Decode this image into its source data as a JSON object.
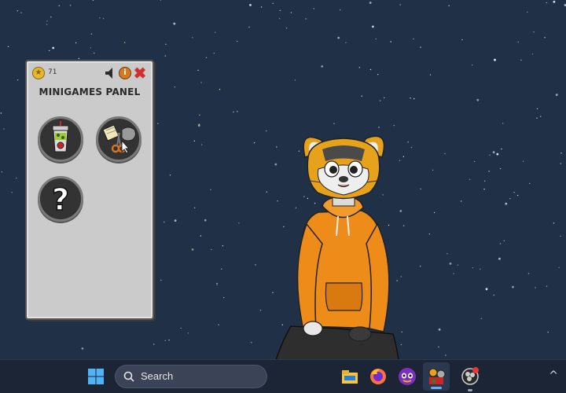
{
  "panel": {
    "title": "MINIGAMES PANEL",
    "coin_count": "71",
    "coin_symbol": "★",
    "info_symbol": "i",
    "close_symbol": "✖",
    "games": [
      {
        "name": "cauldron-game",
        "icon": "potion-bucket-icon"
      },
      {
        "name": "rock-paper-scissors-game",
        "icon": "rock-paper-scissors-icon"
      },
      {
        "name": "mystery-game",
        "icon": "question-mark-icon",
        "symbol": "?"
      }
    ]
  },
  "taskbar": {
    "search_placeholder": "Search",
    "apps": [
      "file-explorer-icon",
      "firefox-icon",
      "purple-mascot-icon",
      "desktop-pet-icon",
      "obs-icon"
    ],
    "tray_chevron": "^"
  },
  "colors": {
    "desktop_bg": "#1f3047",
    "panel_bg": "#cbcbcb",
    "taskbar_bg": "#1b2535",
    "hoodie_orange": "#ee8c1a"
  }
}
